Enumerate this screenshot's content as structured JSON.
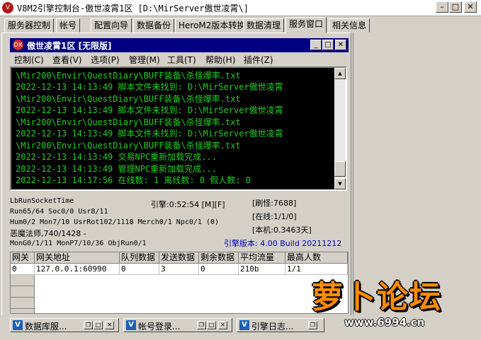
{
  "window": {
    "icon_text": "V",
    "title": "V8M2引擎控制台-傲世凌霄1区 [D:\\MirServer傲世凌霄\\]",
    "btn_min": "–",
    "btn_max": "□",
    "btn_close": "✕"
  },
  "tabs": [
    "服务器控制",
    "帐号",
    "配置向导",
    "数据备份",
    "HeroM2版本转换",
    "数据清理",
    "服务窗口",
    "相关信息"
  ],
  "active_tab": "服务窗口",
  "inner_window": {
    "icon_text": "DX",
    "title": "傲世凌霄1区 [无限版]",
    "btn_min": "_",
    "btn_max": "□",
    "btn_close": "✕"
  },
  "menu": [
    "控制(C)",
    "查看(V)",
    "选项(P)",
    "管理(M)",
    "工具(T)",
    "帮助(H)",
    "插件(Z)"
  ],
  "console_lines": [
    "\\Mir200\\Envir\\QuestDiary\\BUFF装备\\杀怪爆率.txt",
    "2022-12-13 14:13:49 脚本文件未找到: D:\\MirServer傲世凌霄",
    "\\Mir200\\Envir\\QuestDiary\\BUFF装备\\杀怪爆率.txt",
    "2022-12-13 14:13:49 脚本文件未找到: D:\\MirServer傲世凌霄",
    "\\Mir200\\Envir\\QuestDiary\\BUFF装备\\杀怪爆率.txt",
    "2022-12-13 14:13:49 脚本文件未找到: D:\\MirServer傲世凌霄",
    "\\Mir200\\Envir\\QuestDiary\\BUFF装备\\杀怪爆率.txt",
    "2022-12-13 14:13:49 交易NPC重新加载完成...",
    "2022-12-13 14:13:49 管理NPC重新加载完成...",
    "2022-12-13 14:17:56 在线数: 1 离线数: 0 假人数: 0"
  ],
  "stats": {
    "socket_time": "LbRunSocketTime",
    "run": "Run65/64 Soc0/0 Usr8/11",
    "hum": "Hum0/2 Mon7/10 UsrRot102/1118 Merch0/1 Npc0/1 (0)",
    "demon": "恶魔法师,740/1428 -",
    "mongo": "MonG0/1/11 MonP7/10/36 ObjRun0/1",
    "engine_time": "引擎:0:52:54 [M][F]",
    "refresh": "[刷怪:7688]",
    "online": "[在线:1/1/0]",
    "local": "[本机:0.3463天]",
    "version": "引擎版本: 4.00 Build 20211212",
    "version_color": "#0000c0"
  },
  "grid": {
    "headers": [
      "网关",
      "网关地址",
      "队列数据",
      "发送数据",
      "剩余数据",
      "平均流量",
      "最高人数"
    ],
    "rows": [
      [
        "0",
        "127.0.0.1:60990",
        "0",
        "3",
        "0",
        "210b",
        "1/1"
      ]
    ]
  },
  "taskbar": [
    {
      "label": "数据库服...",
      "icon": "V"
    },
    {
      "label": "帐号登录...",
      "icon": "V"
    },
    {
      "label": "引擎日志...",
      "icon": "V"
    }
  ],
  "watermark": {
    "logo": "萝卜论坛",
    "url": "www.6994.cn"
  }
}
